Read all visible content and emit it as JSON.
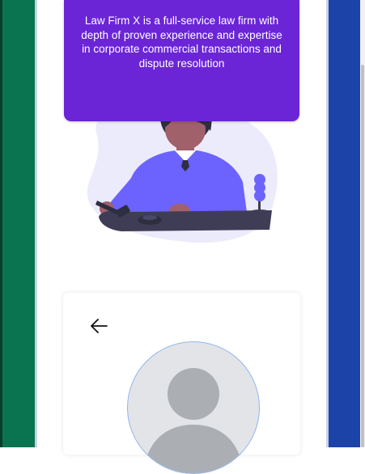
{
  "hero": {
    "description": "Law Firm X is a full-service law firm with depth of proven experience and expertise in corporate commercial transactions and dispute resolution"
  },
  "colors": {
    "hero_background": "#6b25d6",
    "left_panel": "#0a7450",
    "right_panel": "#1c44a8",
    "avatar_border": "#8fb6ee"
  },
  "icons": {
    "back": "arrow-left-icon",
    "avatar": "user-silhouette-icon"
  }
}
